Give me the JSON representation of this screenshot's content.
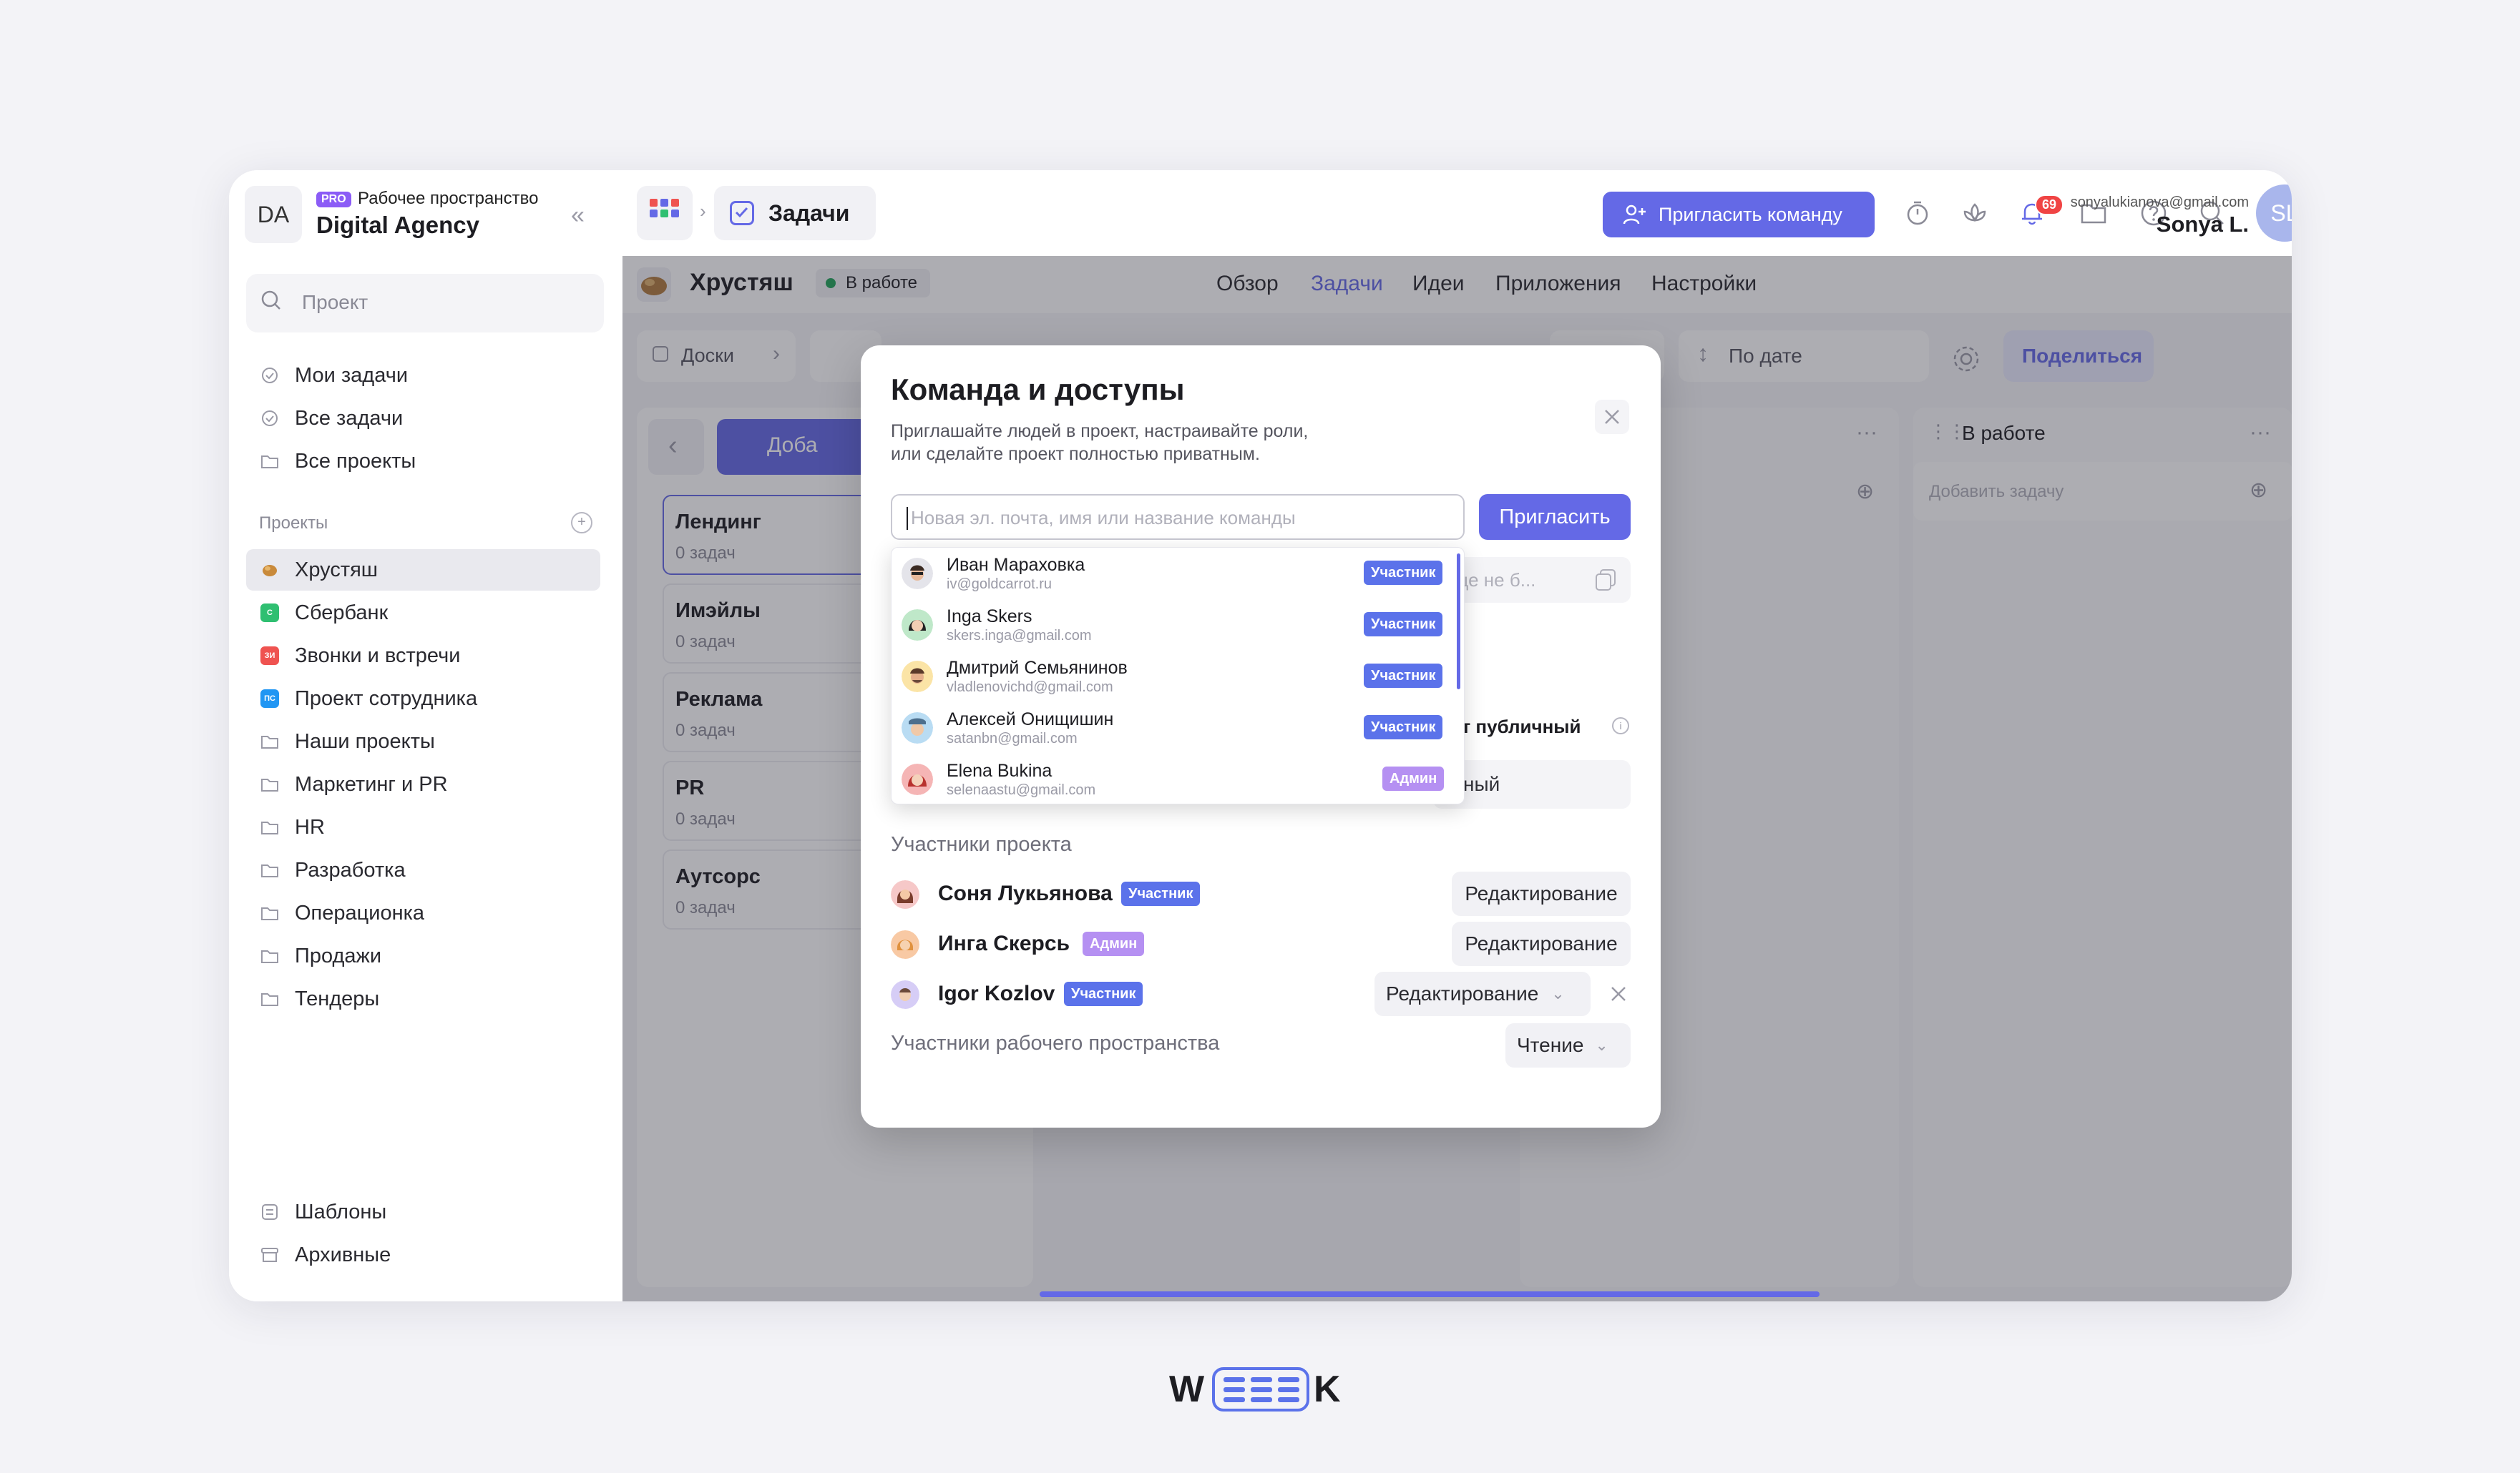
{
  "workspace": {
    "initials": "DA",
    "badge": "PRO",
    "caption": "Рабочее пространство",
    "name": "Digital Agency"
  },
  "sidebar": {
    "search_placeholder": "Проект",
    "main_items": [
      {
        "label": "Мои задачи"
      },
      {
        "label": "Все задачи"
      },
      {
        "label": "Все проекты"
      }
    ],
    "projects_title": "Проекты",
    "projects": [
      {
        "label": "Хрустяш",
        "badge": "",
        "color": "#c98a3a"
      },
      {
        "label": "Сбербанк",
        "badge": "С",
        "color": "#2fbf71"
      },
      {
        "label": "Звонки и встречи",
        "badge": "ЗИ",
        "color": "#ef5350"
      },
      {
        "label": "Проект сотрудника",
        "badge": "ПС",
        "color": "#2196f3"
      },
      {
        "label": "Наши проекты"
      },
      {
        "label": "Маркетинг и PR"
      },
      {
        "label": "HR"
      },
      {
        "label": "Разработка"
      },
      {
        "label": "Операционка"
      },
      {
        "label": "Продажи"
      },
      {
        "label": "Тендеры"
      }
    ],
    "bottom_items": [
      {
        "label": "Шаблоны"
      },
      {
        "label": "Архивные"
      }
    ]
  },
  "topbar": {
    "section": "Задачи",
    "invite_team": "Пригласить команду",
    "notifications_count": "69",
    "user_email": "sonyalukianova@gmail.com",
    "user_name": "Sonya L.",
    "user_initials": "SL"
  },
  "project": {
    "name": "Хрустяш",
    "status": "В работе",
    "tabs": [
      "Обзор",
      "Задачи",
      "Идеи",
      "Приложения",
      "Настройки"
    ],
    "active_tab": "Задачи",
    "boards_label": "Доски",
    "sort_label": "По дате",
    "share_label": "Поделиться",
    "add_board_label": "Доба",
    "boards": [
      {
        "title": "Лендинг",
        "count": "0 задач"
      },
      {
        "title": "Имэйлы",
        "count": "0 задач"
      },
      {
        "title": "Реклама",
        "count": "0 задач"
      },
      {
        "title": "PR",
        "count": "0 задач"
      },
      {
        "title": "Аутсорс",
        "count": "0 задач"
      }
    ],
    "column_in_progress": "В работе",
    "add_task": "Добавить задачу",
    "add_task_cut": "Доб"
  },
  "modal": {
    "title": "Команда и доступы",
    "subtitle_line1": "Приглашайте людей в проект, настраивайте роли,",
    "subtitle_line2": "или сделайте проект полностью приватным.",
    "input_placeholder": "Новая эл. почта, имя или название команды",
    "invite_button": "Пригласить",
    "hidden_link_text": "ще не б...",
    "public_label": "ект публичный",
    "public_select": "ный",
    "members_title": "Участники проекта",
    "members": [
      {
        "name": "Соня Лукьянова",
        "role": "Участник",
        "permission": "Редактирование"
      },
      {
        "name": "Инга Скерсь",
        "role": "Админ",
        "permission": "Редактирование"
      },
      {
        "name": "Igor Kozlov",
        "role": "Участник",
        "permission": "Редактирование"
      }
    ],
    "workspace_members_title": "Участники рабочего пространства",
    "workspace_permission": "Чтение"
  },
  "suggestions": [
    {
      "name": "Иван Мараховка",
      "email": "iv@goldcarrot.ru",
      "role": "Участник"
    },
    {
      "name": "Inga Skers",
      "email": "skers.inga@gmail.com",
      "role": "Участник"
    },
    {
      "name": "Дмитрий Семьянинов",
      "email": "vladlenovichd@gmail.com",
      "role": "Участник"
    },
    {
      "name": "Алексей Онищишин",
      "email": "satanbn@gmail.com",
      "role": "Участник"
    },
    {
      "name": "Elena Bukina",
      "email": "selenaastu@gmail.com",
      "role": "Админ"
    }
  ],
  "colors": {
    "accent": "#6469e6",
    "participant_badge": "#5b72ea",
    "admin_badge": "#b590f2",
    "notification": "#f04444"
  },
  "brand": "WEEEK"
}
